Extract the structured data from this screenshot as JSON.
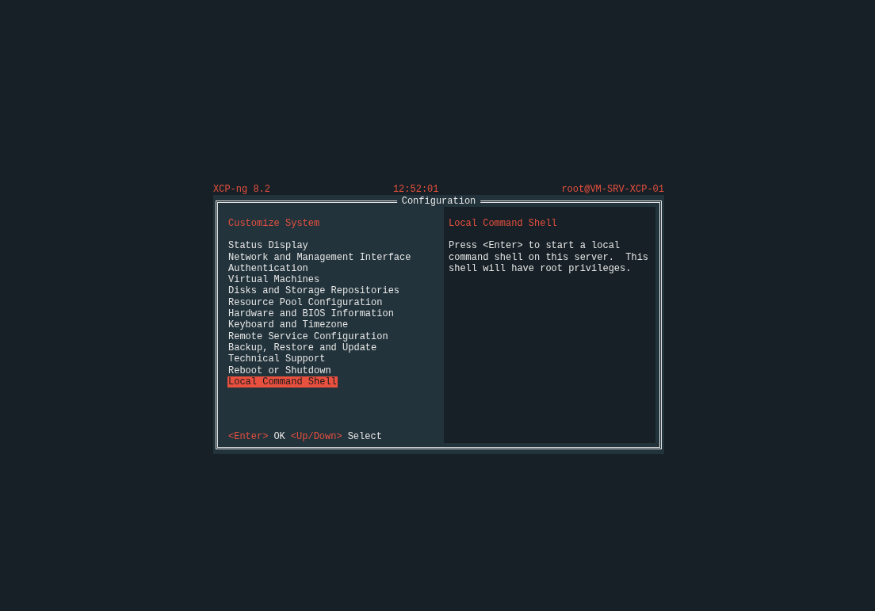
{
  "header": {
    "product": "XCP-ng 8.2",
    "time": "12:52:01",
    "host": "root@VM-SRV-XCP-01"
  },
  "dialog": {
    "title": "Configuration"
  },
  "menu": {
    "title": "Customize System",
    "items": [
      {
        "label": "Status Display",
        "selected": false
      },
      {
        "label": "Network and Management Interface",
        "selected": false
      },
      {
        "label": "Authentication",
        "selected": false
      },
      {
        "label": "Virtual Machines",
        "selected": false
      },
      {
        "label": "Disks and Storage Repositories",
        "selected": false
      },
      {
        "label": "Resource Pool Configuration",
        "selected": false
      },
      {
        "label": "Hardware and BIOS Information",
        "selected": false
      },
      {
        "label": "Keyboard and Timezone",
        "selected": false
      },
      {
        "label": "Remote Service Configuration",
        "selected": false
      },
      {
        "label": "Backup, Restore and Update",
        "selected": false
      },
      {
        "label": "Technical Support",
        "selected": false
      },
      {
        "label": "Reboot or Shutdown",
        "selected": false
      },
      {
        "label": "Local Command Shell",
        "selected": true
      }
    ]
  },
  "detail": {
    "title": "Local Command Shell",
    "lines": [
      "Press <Enter> to start a local",
      "command shell on this server.  This",
      "shell will have root privileges."
    ]
  },
  "hints": [
    {
      "key": "<Enter>",
      "action": "OK"
    },
    {
      "key": "<Up/Down>",
      "action": "Select"
    }
  ]
}
